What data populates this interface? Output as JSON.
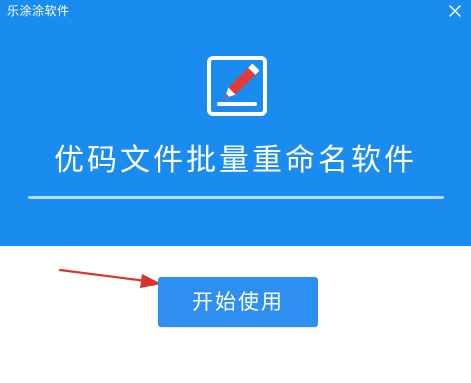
{
  "window": {
    "title": "乐涂涂软件",
    "close_icon": "close-icon"
  },
  "hero": {
    "logo_icon": "edit-document-icon",
    "product_name": "优码文件批量重命名软件",
    "background_color": "#1a8cf0",
    "accent_red": "#e23b3b"
  },
  "actions": {
    "start_label": "开始使用",
    "pointer_arrow_icon": "red-arrow-icon"
  }
}
